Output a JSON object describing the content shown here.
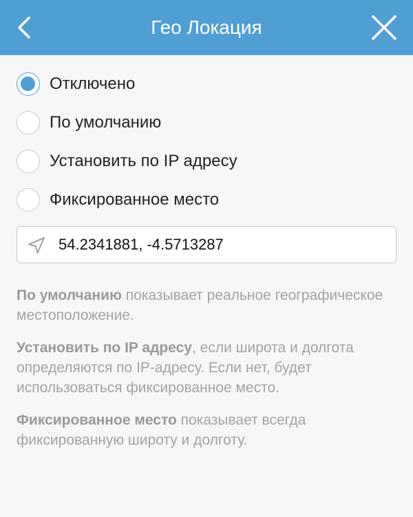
{
  "header": {
    "title": "Гео Локация",
    "back_icon": "chevron-left-icon",
    "close_icon": "close-icon",
    "background_color": "#4f9fd4"
  },
  "options": [
    {
      "label": "Отключено",
      "selected": true
    },
    {
      "label": "По умолчанию",
      "selected": false
    },
    {
      "label": "Установить по IP адресу",
      "selected": false
    },
    {
      "label": "Фиксированное место",
      "selected": false
    }
  ],
  "coordinates": {
    "icon": "location-arrow-icon",
    "value": "54.2341881, -4.5713287"
  },
  "help": [
    {
      "bold": "По умолчанию",
      "text": " показывает реальное географическое местоположение."
    },
    {
      "bold": "Установить по IP адресу",
      "text": ", если широта и долгота определяются по IP-адресу. Если нет, будет использоваться фиксированное место."
    },
    {
      "bold": "Фиксированное место",
      "text": " показывает всегда фиксированную широту и долготу."
    }
  ],
  "colors": {
    "accent": "#4f9fd4",
    "help_text": "#a3a3a3"
  }
}
